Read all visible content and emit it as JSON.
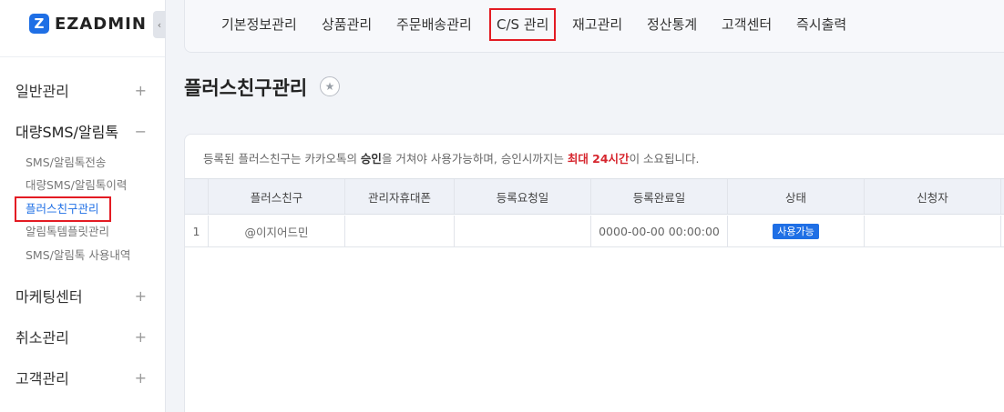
{
  "brand": {
    "logo_text": "EZADMIN",
    "collapse_glyph": "‹"
  },
  "sidebar": {
    "groups": [
      {
        "label": "일반관리",
        "toggle": "+"
      },
      {
        "label": "대량SMS/알림톡",
        "toggle": "−"
      },
      {
        "label": "마케팅센터",
        "toggle": "+"
      },
      {
        "label": "취소관리",
        "toggle": "+"
      },
      {
        "label": "고객관리",
        "toggle": "+"
      }
    ],
    "sub_items": [
      {
        "label": "SMS/알림톡전송"
      },
      {
        "label": "대량SMS/알림톡이력"
      },
      {
        "label": "플러스친구관리"
      },
      {
        "label": "알림톡템플릿관리"
      },
      {
        "label": "SMS/알림톡 사용내역"
      }
    ]
  },
  "topnav": {
    "items": [
      {
        "label": "기본정보관리"
      },
      {
        "label": "상품관리"
      },
      {
        "label": "주문배송관리"
      },
      {
        "label": "C/S 관리"
      },
      {
        "label": "재고관리"
      },
      {
        "label": "정산통계"
      },
      {
        "label": "고객센터"
      },
      {
        "label": "즉시출력"
      }
    ]
  },
  "page": {
    "title": "플러스친구관리",
    "star_glyph": "★"
  },
  "notice": {
    "part1": "등록된 플러스친구는 카카오톡의 ",
    "bold": "승인",
    "part2": "을 거쳐야 사용가능하며, 승인시까지는 ",
    "red": "최대 24시간",
    "part3": "이 소요됩니다."
  },
  "table": {
    "headers": [
      "",
      "플러스친구",
      "관리자휴대폰",
      "등록요청일",
      "등록완료일",
      "상태",
      "신청자"
    ],
    "rows": [
      {
        "no": "1",
        "friend": "@이지어드민",
        "phone": "",
        "request_date": "",
        "complete_date": "0000-00-00 00:00:00",
        "status": "사용가능",
        "applicant": ""
      }
    ]
  },
  "colors": {
    "accent": "#1f6fe5",
    "highlight": "#e31b23",
    "notice_red": "#d6262e"
  }
}
